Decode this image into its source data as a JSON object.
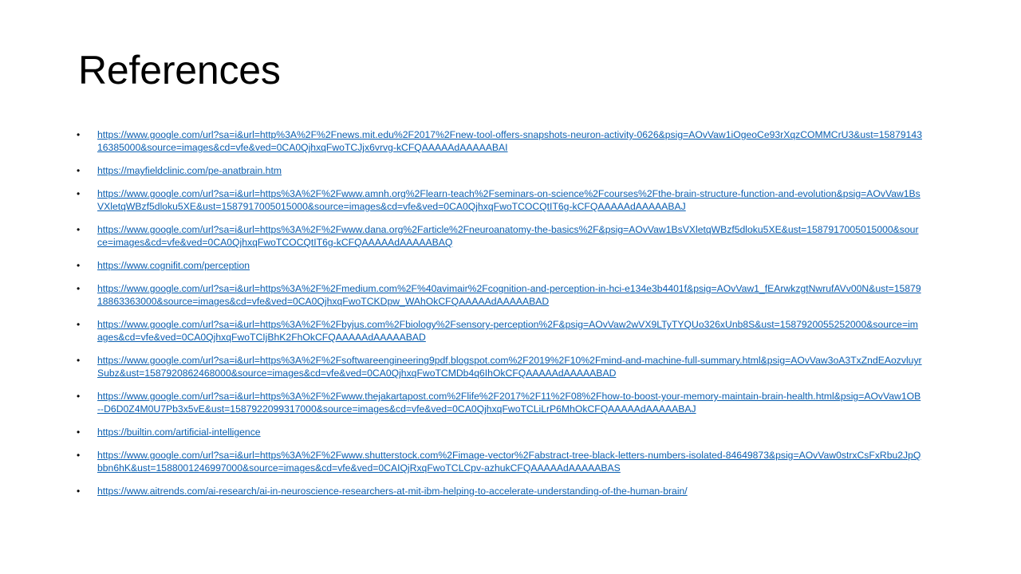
{
  "slide": {
    "title": "References",
    "references": [
      "https://www.google.com/url?sa=i&url=http%3A%2F%2Fnews.mit.edu%2F2017%2Fnew-tool-offers-snapshots-neuron-activity-0626&psig=AOvVaw1iOgeoCe93rXqzCOMMCrU3&ust=1587914316385000&source=images&cd=vfe&ved=0CA0QjhxqFwoTCJjx6vrvg-kCFQAAAAAdAAAAABAI",
      "https://mayfieldclinic.com/pe-anatbrain.htm",
      "https://www.google.com/url?sa=i&url=https%3A%2F%2Fwww.amnh.org%2Flearn-teach%2Fseminars-on-science%2Fcourses%2Fthe-brain-structure-function-and-evolution&psig=AOvVaw1BsVXletqWBzf5dloku5XE&ust=1587917005015000&source=images&cd=vfe&ved=0CA0QjhxqFwoTCOCQtIT6g-kCFQAAAAAdAAAAABAJ",
      "https://www.google.com/url?sa=i&url=https%3A%2F%2Fwww.dana.org%2Farticle%2Fneuroanatomy-the-basics%2F&psig=AOvVaw1BsVXletqWBzf5dloku5XE&ust=1587917005015000&source=images&cd=vfe&ved=0CA0QjhxqFwoTCOCQtIT6g-kCFQAAAAAdAAAAABAQ",
      "https://www.cognifit.com/perception",
      "https://www.google.com/url?sa=i&url=https%3A%2F%2Fmedium.com%2F%40avimair%2Fcognition-and-perception-in-hci-e134e3b4401f&psig=AOvVaw1_fEArwkzgtNwrufAVv00N&ust=1587918863363000&source=images&cd=vfe&ved=0CA0QjhxqFwoTCKDpw_WAhOkCFQAAAAAdAAAAABAD",
      "https://www.google.com/url?sa=i&url=https%3A%2F%2Fbyjus.com%2Fbiology%2Fsensory-perception%2F&psig=AOvVaw2wVX9LTyTYQUo326xUnb8S&ust=1587920055252000&source=images&cd=vfe&ved=0CA0QjhxqFwoTCIjBhK2FhOkCFQAAAAAdAAAAABAD",
      "https://www.google.com/url?sa=i&url=https%3A%2F%2Fsoftwareengineering9pdf.blogspot.com%2F2019%2F10%2Fmind-and-machine-full-summary.html&psig=AOvVaw3oA3TxZndEAozvluyrSubz&ust=1587920862468000&source=images&cd=vfe&ved=0CA0QjhxqFwoTCMDb4q6IhOkCFQAAAAAdAAAAABAD",
      "https://www.google.com/url?sa=i&url=https%3A%2F%2Fwww.thejakartapost.com%2Flife%2F2017%2F11%2F08%2Fhow-to-boost-your-memory-maintain-brain-health.html&psig=AOvVaw1OB--D6D0Z4M0U7Pb3x5vE&ust=1587922099317000&source=images&cd=vfe&ved=0CA0QjhxqFwoTCLiLrP6MhOkCFQAAAAAdAAAAABAJ",
      "https://builtin.com/artificial-intelligence",
      "https://www.google.com/url?sa=i&url=https%3A%2F%2Fwww.shutterstock.com%2Fimage-vector%2Fabstract-tree-black-letters-numbers-isolated-84649873&psig=AOvVaw0strxCsFxRbu2JpQbbn6hK&ust=1588001246997000&source=images&cd=vfe&ved=0CAIQjRxqFwoTCLCpv-azhukCFQAAAAAdAAAAABAS",
      "https://www.aitrends.com/ai-research/ai-in-neuroscience-researchers-at-mit-ibm-helping-to-accelerate-understanding-of-the-human-brain/"
    ],
    "bullet_glyph": "•",
    "link_color": "#0b5fb0"
  }
}
